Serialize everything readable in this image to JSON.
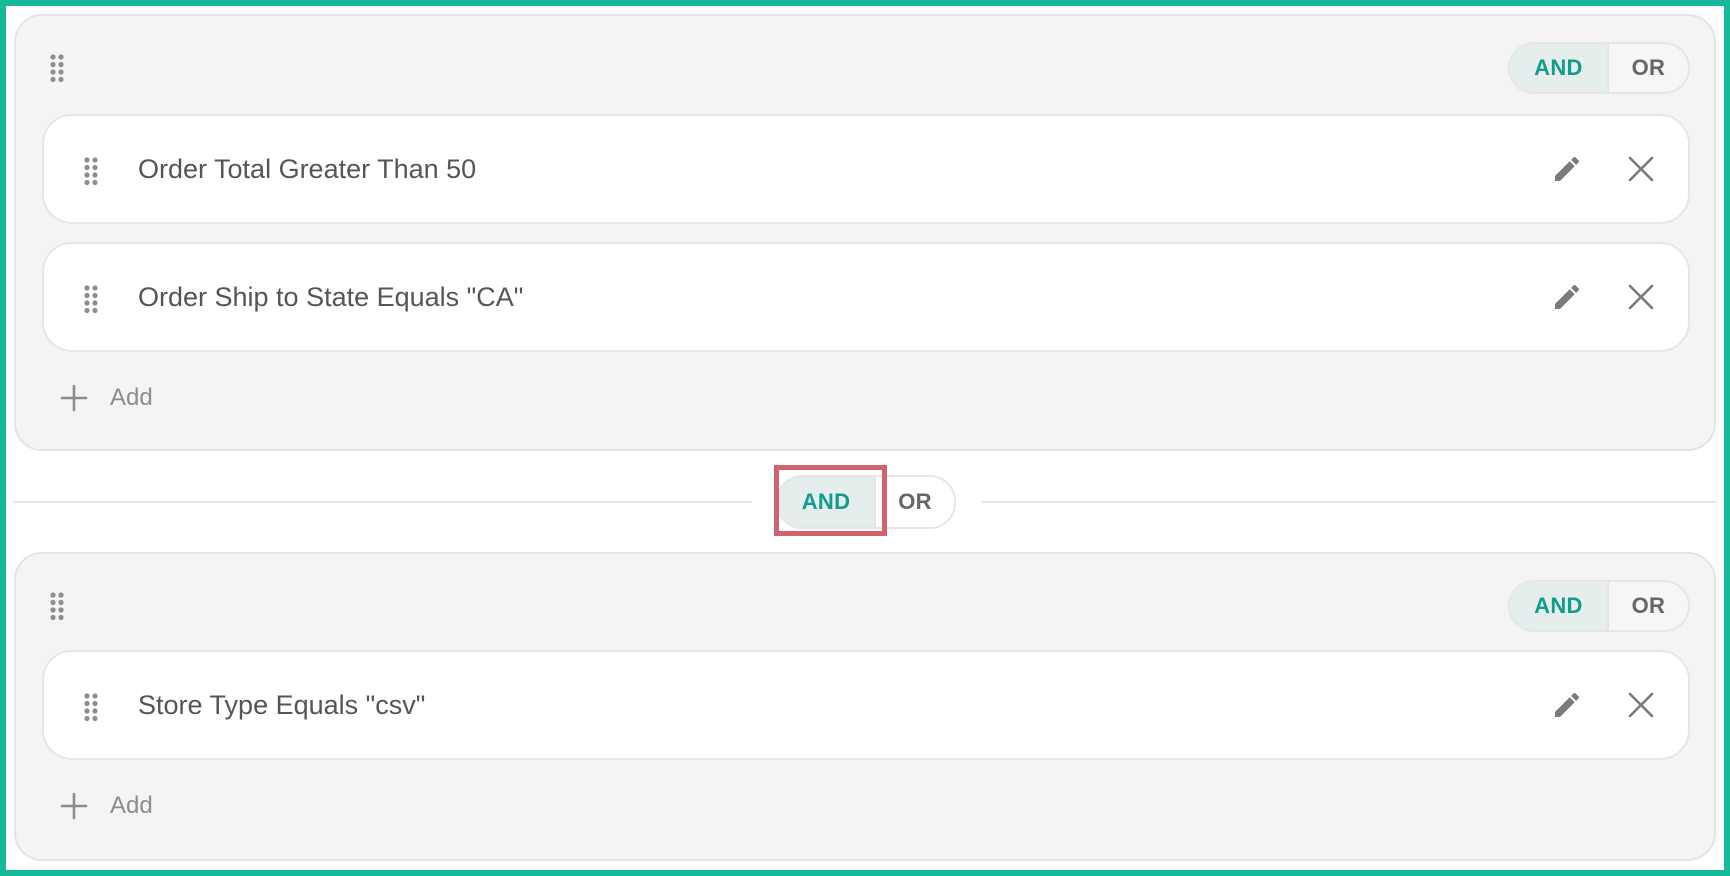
{
  "colors": {
    "frame_border": "#16b89a",
    "accent_teal": "#129c8c",
    "highlight": "#d0636f"
  },
  "groups": [
    {
      "operator": {
        "and_label": "AND",
        "or_label": "OR",
        "selected": "AND"
      },
      "rules": [
        {
          "text": "Order Total Greater Than 50",
          "edit_icon": "pencil-icon",
          "remove_icon": "close-icon"
        },
        {
          "text": "Order Ship to State Equals \"CA\"",
          "edit_icon": "pencil-icon",
          "remove_icon": "close-icon"
        }
      ],
      "add_label": "Add"
    },
    {
      "operator": {
        "and_label": "AND",
        "or_label": "OR",
        "selected": "AND"
      },
      "rules": [
        {
          "text": "Store Type Equals \"csv\"",
          "edit_icon": "pencil-icon",
          "remove_icon": "close-icon"
        }
      ],
      "add_label": "Add"
    }
  ],
  "between_groups_operator": {
    "and_label": "AND",
    "or_label": "OR",
    "selected": "AND"
  }
}
